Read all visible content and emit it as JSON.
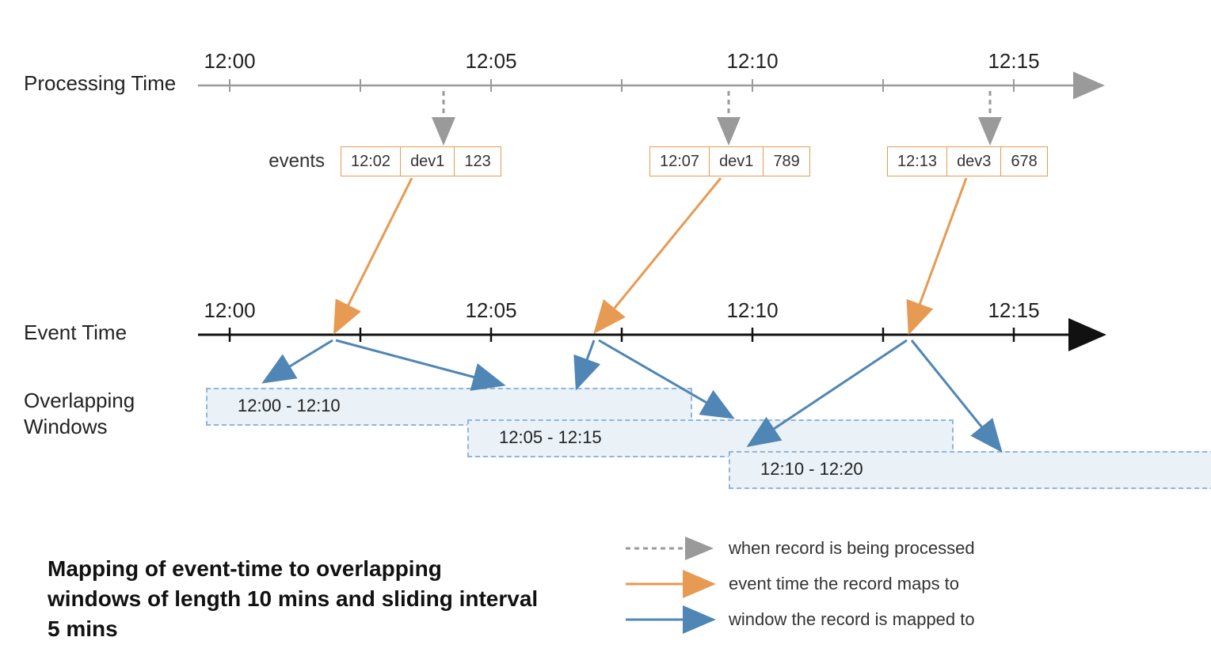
{
  "labels": {
    "processing_time": "Processing Time",
    "event_time": "Event Time",
    "overlapping_windows": "Overlapping Windows",
    "events": "events"
  },
  "ticks": [
    "12:00",
    "12:05",
    "12:10",
    "12:15"
  ],
  "events": [
    {
      "time": "12:02",
      "device": "dev1",
      "value": "123"
    },
    {
      "time": "12:07",
      "device": "dev1",
      "value": "789"
    },
    {
      "time": "12:13",
      "device": "dev3",
      "value": "678"
    }
  ],
  "windows": [
    "12:00 - 12:10",
    "12:05 - 12:15",
    "12:10 - 12:20"
  ],
  "caption": "Mapping of event-time to overlapping windows of length 10 mins and sliding interval 5 mins",
  "legend": {
    "processed": "when record is being processed",
    "maps_to": "event time the record maps to",
    "window_mapped": "window the record is mapped to"
  },
  "chart_data": {
    "type": "diagram",
    "description": "Events arriving at processing time are mapped to their event-time position and then assigned to every sliding window that covers that event time.",
    "processing_time_axis": {
      "ticks": [
        "12:00",
        "12:05",
        "12:10",
        "12:15"
      ]
    },
    "event_time_axis": {
      "ticks": [
        "12:00",
        "12:05",
        "12:10",
        "12:15"
      ]
    },
    "sliding_window": {
      "length_minutes": 10,
      "slide_minutes": 5
    },
    "records": [
      {
        "event_time": "12:02",
        "device": "dev1",
        "value": 123,
        "processing_time": "≈12:04",
        "windows": [
          "12:00 - 12:10"
        ],
        "also_points_left": true
      },
      {
        "event_time": "12:07",
        "device": "dev1",
        "value": 789,
        "processing_time": "≈12:09",
        "windows": [
          "12:00 - 12:10",
          "12:05 - 12:15"
        ]
      },
      {
        "event_time": "12:13",
        "device": "dev3",
        "value": 678,
        "processing_time": "≈12:14",
        "windows": [
          "12:05 - 12:15",
          "12:10 - 12:20"
        ]
      }
    ],
    "windows": [
      {
        "label": "12:00 - 12:10",
        "start": "12:00",
        "end": "12:10"
      },
      {
        "label": "12:05 - 12:15",
        "start": "12:05",
        "end": "12:15"
      },
      {
        "label": "12:10 - 12:20",
        "start": "12:10",
        "end": "12:20"
      }
    ]
  }
}
